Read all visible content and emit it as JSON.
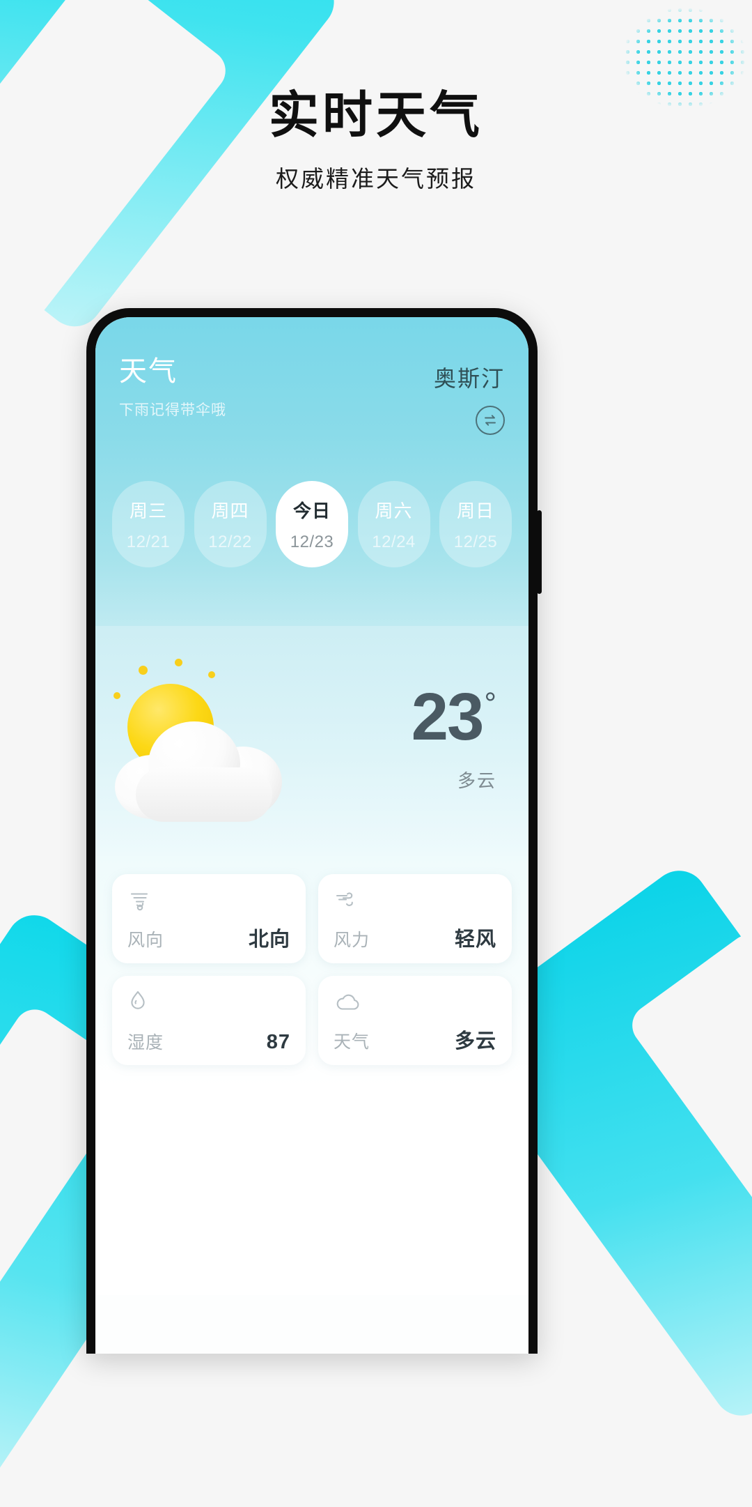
{
  "promo": {
    "title": "实时天气",
    "subtitle": "权威精准天气预报"
  },
  "app": {
    "name": "天气",
    "tagline": "下雨记得带伞哦",
    "city": "奥斯汀",
    "unit_toggle_icon": "unit-swap-icon"
  },
  "days": [
    {
      "dow": "周三",
      "date": "12/21",
      "selected": false
    },
    {
      "dow": "周四",
      "date": "12/22",
      "selected": false
    },
    {
      "dow": "今日",
      "date": "12/23",
      "selected": true
    },
    {
      "dow": "周六",
      "date": "12/24",
      "selected": false
    },
    {
      "dow": "周日",
      "date": "12/25",
      "selected": false
    }
  ],
  "current": {
    "temperature": "23",
    "degree_symbol": "°",
    "condition": "多云",
    "art_icon": "sun-behind-cloud-icon"
  },
  "info_cards": [
    {
      "icon": "wind-direction-icon",
      "label": "风向",
      "value": "北向"
    },
    {
      "icon": "wind-speed-icon",
      "label": "风力",
      "value": "轻风"
    },
    {
      "icon": "humidity-drop-icon",
      "label": "湿度",
      "value": "87"
    },
    {
      "icon": "cloud-icon",
      "label": "天气",
      "value": "多云"
    }
  ],
  "colors": {
    "accent_cyan": "#14dced",
    "sky_top": "#79d7e9",
    "sky_bottom": "#bfeaf1",
    "card_bg": "#ffffff",
    "temp_text": "#4a5a63",
    "label_text": "#a9b2b7",
    "page_bg": "#f6f6f6"
  }
}
